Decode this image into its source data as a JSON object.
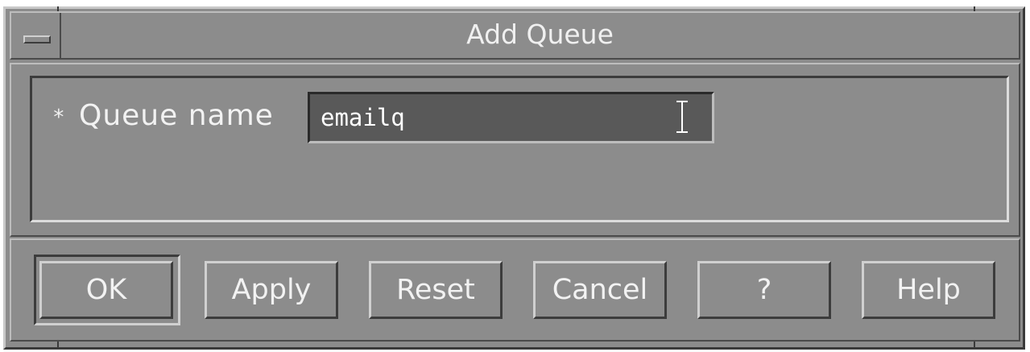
{
  "window": {
    "title": "Add Queue"
  },
  "form": {
    "required_mark": "*",
    "queue_name_label": "Queue name",
    "queue_name_value": "emailq"
  },
  "buttons": {
    "ok": "OK",
    "apply": "Apply",
    "reset": "Reset",
    "cancel": "Cancel",
    "question": "?",
    "help": "Help"
  },
  "colors": {
    "window_bg": "#8c8c8c",
    "input_bg": "#595959",
    "text": "#f2f2f2"
  }
}
